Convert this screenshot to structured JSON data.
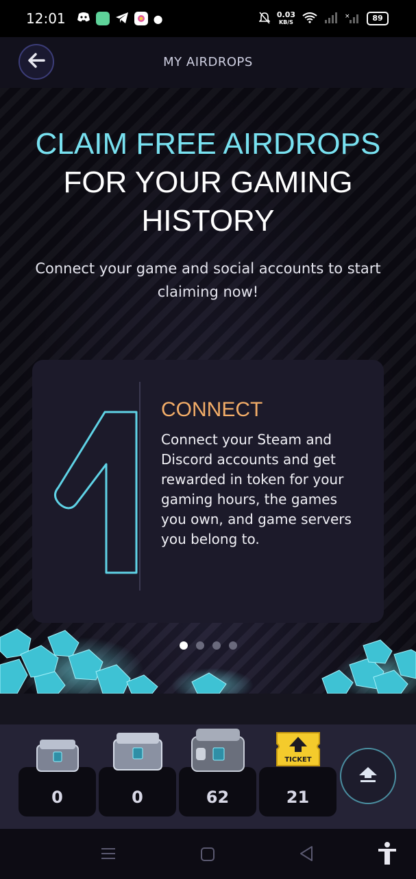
{
  "status_bar": {
    "time": "12:01",
    "net_speed_value": "0.03",
    "net_speed_unit": "KB/S",
    "battery": "89",
    "icons": [
      "discord-icon",
      "app-icon",
      "telegram-icon",
      "photos-icon",
      "dot-icon",
      "mute-icon",
      "wifi-icon",
      "signal-icon",
      "signal-off-icon",
      "battery-icon"
    ]
  },
  "header": {
    "title": "MY AIRDROPS",
    "back_icon": "arrow-left-icon"
  },
  "hero": {
    "headline_line1": "CLAIM FREE AIRDROPS",
    "headline_line2": "FOR YOUR GAMING",
    "headline_line3": "HISTORY",
    "subtitle": "Connect your game and social accounts to start claiming now!",
    "accent_cyan": "#78e1f0",
    "accent_orange": "#f3ad68"
  },
  "card": {
    "step_number": "1",
    "title": "CONNECT",
    "body": "Connect your Steam and Discord accounts and get rewarded in token for your gaming hours, the games you own, and game servers you belong to."
  },
  "pagination": {
    "total": 4,
    "active": 1
  },
  "inventory": [
    {
      "icon": "small-crate-icon",
      "count": "0"
    },
    {
      "icon": "medium-crate-icon",
      "count": "0"
    },
    {
      "icon": "large-crate-icon",
      "count": "62"
    },
    {
      "icon": "ticket-icon",
      "count": "21",
      "label": "TICKET"
    }
  ],
  "upgrade_button_icon": "upgrade-arrow-icon",
  "nav_bar": [
    "menu-icon",
    "home-icon",
    "back-triangle-icon",
    "accessibility-icon"
  ]
}
